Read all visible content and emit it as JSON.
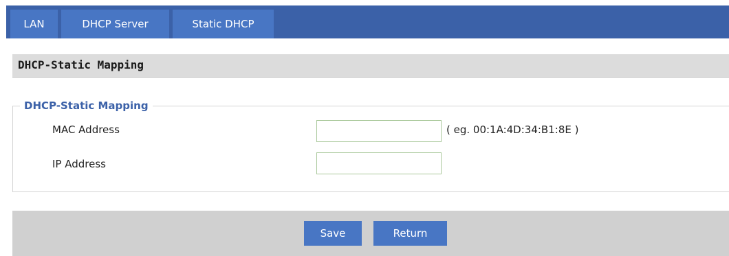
{
  "tabs": [
    {
      "label": "LAN"
    },
    {
      "label": "DHCP Server"
    },
    {
      "label": "Static DHCP"
    }
  ],
  "section": {
    "title": "DHCP-Static Mapping"
  },
  "fieldset": {
    "legend": "DHCP-Static Mapping",
    "mac": {
      "label": "MAC Address",
      "value": "",
      "hint": "( eg. 00:1A:4D:34:B1:8E )"
    },
    "ip": {
      "label": "IP Address",
      "value": ""
    }
  },
  "buttons": {
    "save": "Save",
    "return": "Return"
  },
  "colors": {
    "tabbar_bg": "#3b61a8",
    "tab_bg": "#4876c4",
    "legend_text": "#3b61a8",
    "button_bg": "#4876c4",
    "button_bar_bg": "#d0d0d0",
    "section_header_bg": "#dcdcdc"
  }
}
